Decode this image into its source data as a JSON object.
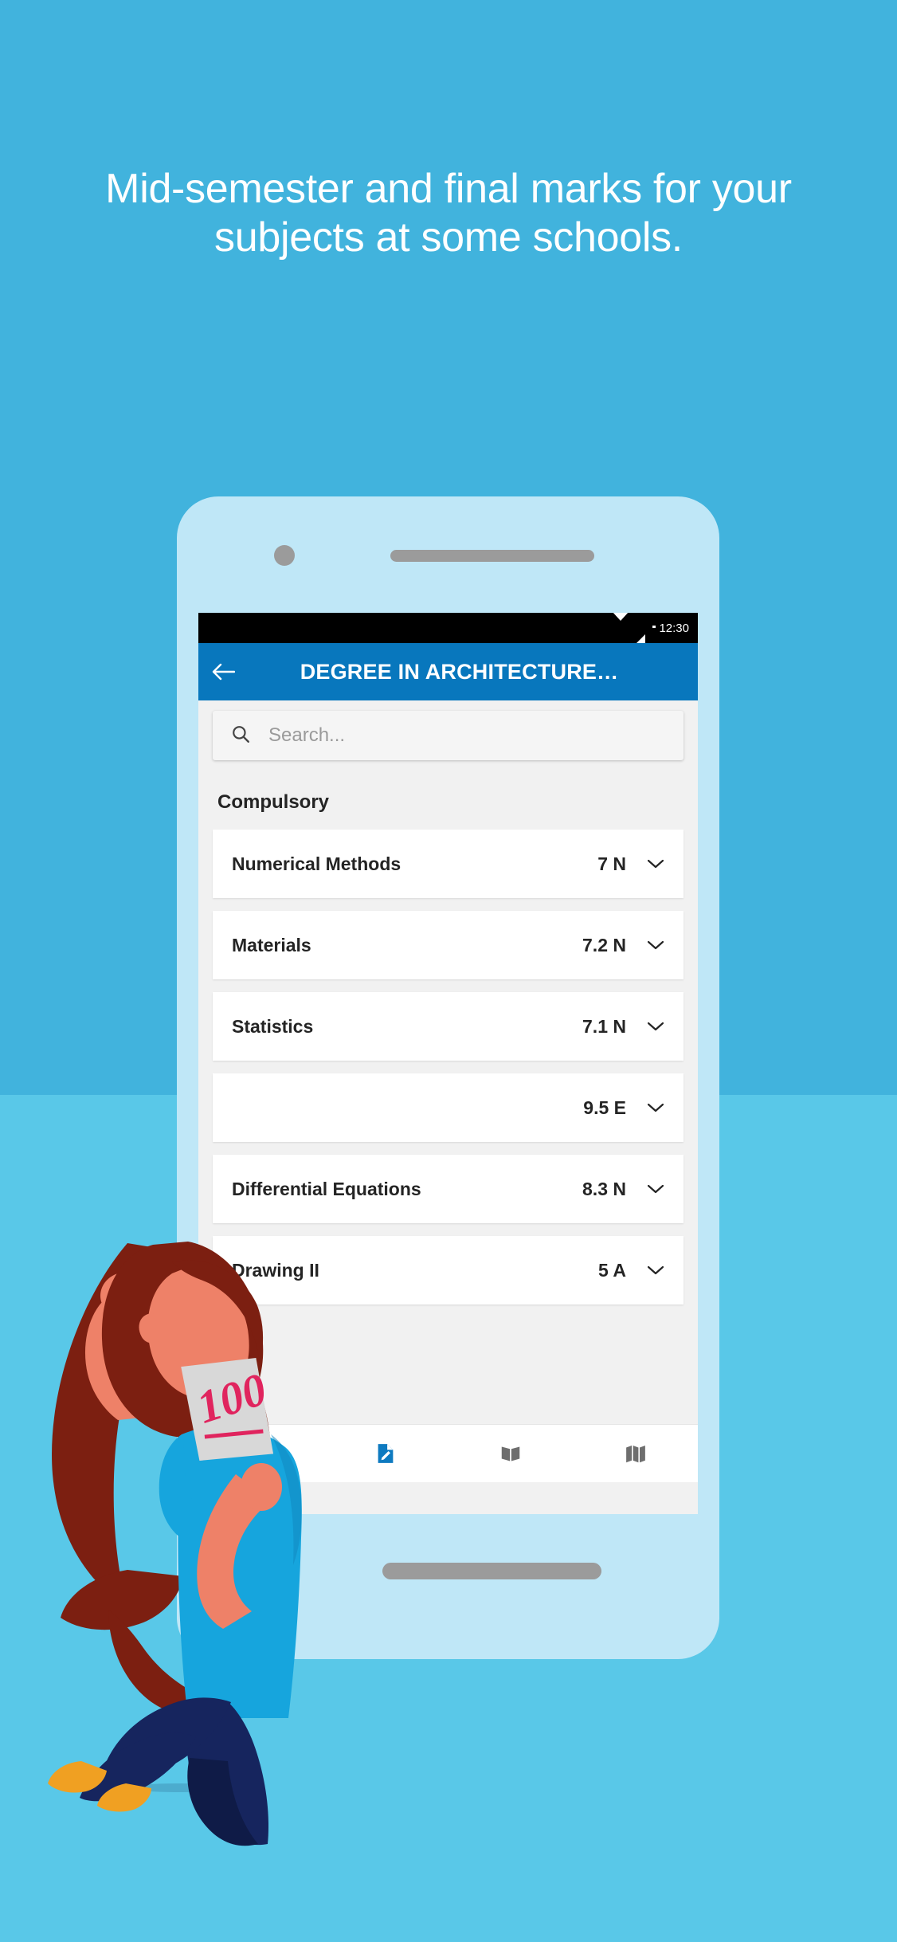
{
  "promo": {
    "headline": "Mid-semester and final marks for your subjects at some schools.",
    "background_top_color": "#41b3dd",
    "background_bottom_color": "#59c8e8"
  },
  "phone": {
    "frame_color": "#bfe7f7",
    "camera_icon": "camera-dot",
    "speaker_icon": "speaker-bar",
    "home_indicator": "home-bar"
  },
  "statusbar": {
    "time": "12:30",
    "wifi_icon": "wifi-icon",
    "signal_icon": "signal-icon",
    "battery_icon": "battery-icon"
  },
  "appbar": {
    "back_icon": "back-arrow-icon",
    "title": "DEGREE IN ARCHITECTURE…",
    "color": "#0877bd"
  },
  "search": {
    "icon": "search-icon",
    "placeholder": "Search...",
    "value": ""
  },
  "list": {
    "section_title": "Compulsory",
    "rows": [
      {
        "name": "Numerical Methods",
        "mark": "7 N",
        "chevron": "chevron-down-icon"
      },
      {
        "name": "Materials",
        "mark": "7.2 N",
        "chevron": "chevron-down-icon"
      },
      {
        "name": "Statistics",
        "mark": "7.1 N",
        "chevron": "chevron-down-icon"
      },
      {
        "name": "",
        "mark": "9.5 E",
        "chevron": "chevron-down-icon"
      },
      {
        "name": "Differential Equations",
        "mark": "8.3 N",
        "chevron": "chevron-down-icon"
      },
      {
        "name": "Drawing II",
        "mark": "5 A",
        "chevron": "chevron-down-icon"
      }
    ]
  },
  "bottom_nav": {
    "active_color": "#0e7ac0",
    "inactive_color": "#6e6e6e",
    "items": [
      {
        "icon": "calendar-icon",
        "active": false
      },
      {
        "icon": "document-pencil-icon",
        "active": true
      },
      {
        "icon": "open-book-icon",
        "active": false
      },
      {
        "icon": "folded-map-icon",
        "active": false
      }
    ]
  },
  "illustration": {
    "name": "celebrating-student-illustration",
    "hair_color": "#7c1f11",
    "skin_color": "#ee8168",
    "shirt_color": "#16a5dd",
    "pants_color": "#16255e",
    "shoe_color": "#f0a022",
    "paper_color": "#d8d8d8",
    "paper_mark": "100",
    "paper_mark_color": "#e0245e"
  }
}
